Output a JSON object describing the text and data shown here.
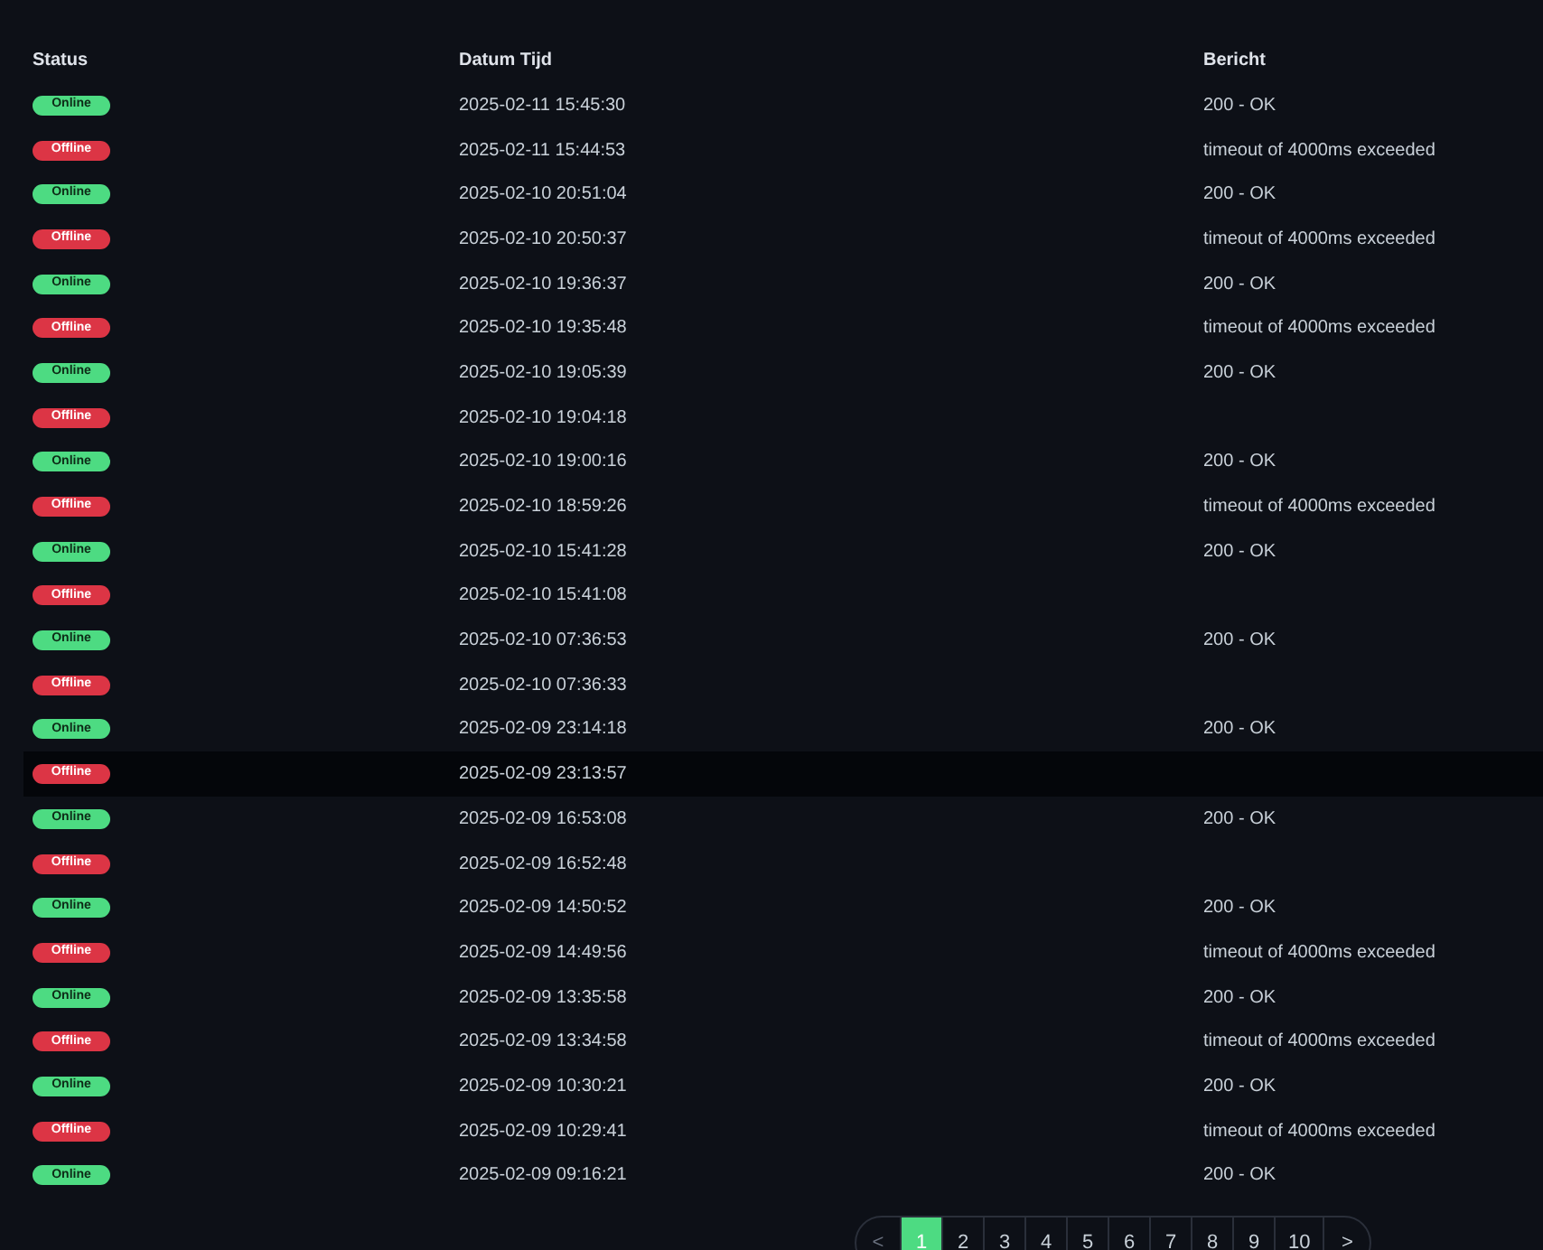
{
  "table": {
    "columns": [
      "Status",
      "Datum Tijd",
      "Bericht"
    ],
    "rows": [
      {
        "status": "Online",
        "kind": "online",
        "time": "2025-02-11 15:45:30",
        "message": "200 - OK",
        "highlighted": false
      },
      {
        "status": "Offline",
        "kind": "offline",
        "time": "2025-02-11 15:44:53",
        "message": "timeout of 4000ms exceeded",
        "highlighted": false
      },
      {
        "status": "Online",
        "kind": "online",
        "time": "2025-02-10 20:51:04",
        "message": "200 - OK",
        "highlighted": false
      },
      {
        "status": "Offline",
        "kind": "offline",
        "time": "2025-02-10 20:50:37",
        "message": "timeout of 4000ms exceeded",
        "highlighted": false
      },
      {
        "status": "Online",
        "kind": "online",
        "time": "2025-02-10 19:36:37",
        "message": "200 - OK",
        "highlighted": false
      },
      {
        "status": "Offline",
        "kind": "offline",
        "time": "2025-02-10 19:35:48",
        "message": "timeout of 4000ms exceeded",
        "highlighted": false
      },
      {
        "status": "Online",
        "kind": "online",
        "time": "2025-02-10 19:05:39",
        "message": "200 - OK",
        "highlighted": false
      },
      {
        "status": "Offline",
        "kind": "offline",
        "time": "2025-02-10 19:04:18",
        "highlighted": false
      },
      {
        "status": "Online",
        "kind": "online",
        "time": "2025-02-10 19:00:16",
        "message": "200 - OK",
        "highlighted": false
      },
      {
        "status": "Offline",
        "kind": "offline",
        "time": "2025-02-10 18:59:26",
        "message": "timeout of 4000ms exceeded",
        "highlighted": false
      },
      {
        "status": "Online",
        "kind": "online",
        "time": "2025-02-10 15:41:28",
        "message": "200 - OK",
        "highlighted": false
      },
      {
        "status": "Offline",
        "kind": "offline",
        "time": "2025-02-10 15:41:08",
        "highlighted": false
      },
      {
        "status": "Online",
        "kind": "online",
        "time": "2025-02-10 07:36:53",
        "message": "200 - OK",
        "highlighted": false
      },
      {
        "status": "Offline",
        "kind": "offline",
        "time": "2025-02-10 07:36:33",
        "highlighted": false
      },
      {
        "status": "Online",
        "kind": "online",
        "time": "2025-02-09 23:14:18",
        "message": "200 - OK",
        "highlighted": false
      },
      {
        "status": "Offline",
        "kind": "offline",
        "time": "2025-02-09 23:13:57",
        "highlighted": true
      },
      {
        "status": "Online",
        "kind": "online",
        "time": "2025-02-09 16:53:08",
        "message": "200 - OK",
        "highlighted": false
      },
      {
        "status": "Offline",
        "kind": "offline",
        "time": "2025-02-09 16:52:48",
        "highlighted": false
      },
      {
        "status": "Online",
        "kind": "online",
        "time": "2025-02-09 14:50:52",
        "message": "200 - OK",
        "highlighted": false
      },
      {
        "status": "Offline",
        "kind": "offline",
        "time": "2025-02-09 14:49:56",
        "message": "timeout of 4000ms exceeded",
        "highlighted": false
      },
      {
        "status": "Online",
        "kind": "online",
        "time": "2025-02-09 13:35:58",
        "message": "200 - OK",
        "highlighted": false
      },
      {
        "status": "Offline",
        "kind": "offline",
        "time": "2025-02-09 13:34:58",
        "message": "timeout of 4000ms exceeded",
        "highlighted": false
      },
      {
        "status": "Online",
        "kind": "online",
        "time": "2025-02-09 10:30:21",
        "message": "200 - OK",
        "highlighted": false
      },
      {
        "status": "Offline",
        "kind": "offline",
        "time": "2025-02-09 10:29:41",
        "message": "timeout of 4000ms exceeded",
        "highlighted": false
      },
      {
        "status": "Online",
        "kind": "online",
        "time": "2025-02-09 09:16:21",
        "message": "200 - OK",
        "highlighted": false
      }
    ]
  },
  "pagination": {
    "previous": "<",
    "next": ">",
    "pages": [
      {
        "label": "1",
        "selected": true
      },
      {
        "label": "2",
        "selected": false
      },
      {
        "label": "3",
        "selected": false
      },
      {
        "label": "4",
        "selected": false
      },
      {
        "label": "5",
        "selected": false
      },
      {
        "label": "6",
        "selected": false
      },
      {
        "label": "7",
        "selected": false
      },
      {
        "label": "8",
        "selected": false
      },
      {
        "label": "9",
        "selected": false
      },
      {
        "label": "10",
        "selected": false
      }
    ]
  }
}
